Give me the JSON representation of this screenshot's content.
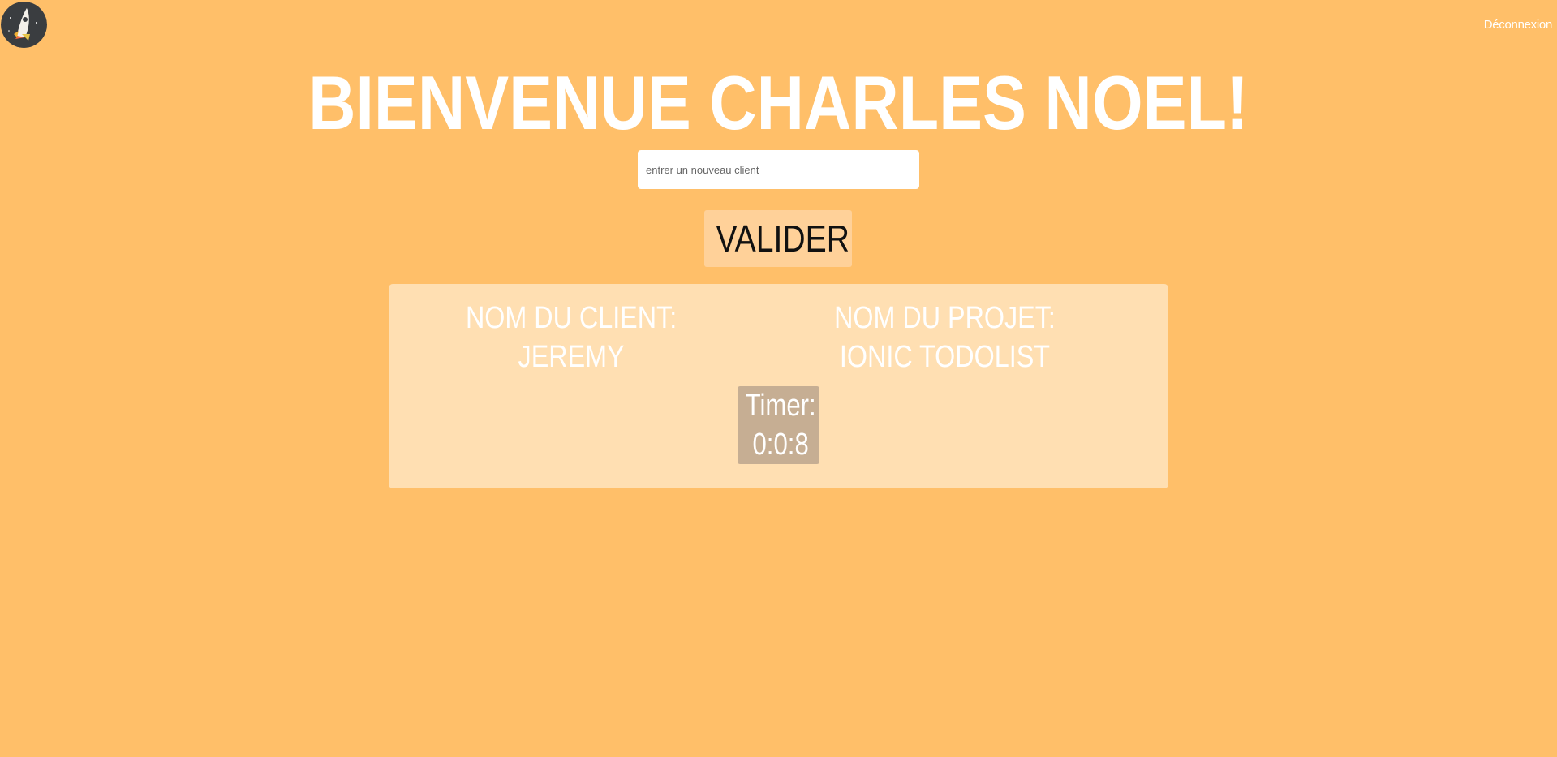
{
  "header": {
    "logout_label": "Déconnexion"
  },
  "main": {
    "title": "BIENVENUE CHARLES NOEL!",
    "client_input_placeholder": "entrer un nouveau client",
    "submit_label": "VALIDER"
  },
  "card": {
    "client_label": "NOM DU CLIENT:",
    "client_value": "JEREMY",
    "project_label": "NOM DU PROJET:",
    "project_value": "IONIC TODOLIST",
    "timer_label": "Timer:",
    "timer_value": "0:0:8"
  },
  "colors": {
    "background": "#FFBF69",
    "card": "#FFDFB2",
    "button": "#FFD199",
    "timer": "#C6AE93"
  },
  "icons": {
    "logo": "rocket-icon"
  }
}
